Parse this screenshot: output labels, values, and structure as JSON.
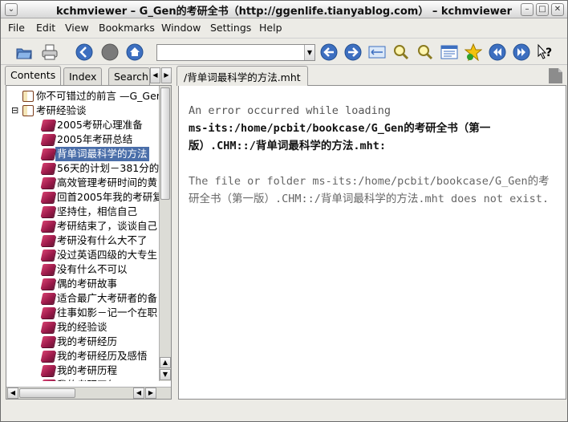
{
  "window": {
    "title": "kchmviewer – G_Gen的考研全书（http://ggenlife.tianyablog.com） – kchmviewer"
  },
  "menu": [
    {
      "label": "File"
    },
    {
      "label": "Edit"
    },
    {
      "label": "View"
    },
    {
      "label": "Bookmarks"
    },
    {
      "label": "Window"
    },
    {
      "label": "Settings"
    },
    {
      "label": "Help"
    }
  ],
  "toolbar": {
    "icons": [
      "open-icon",
      "print-icon",
      "back-icon",
      "stop-icon",
      "home-icon",
      "prev-icon",
      "next-icon",
      "fit-icon",
      "zoom-in-icon",
      "zoom-out-icon",
      "view-source-icon",
      "bookmark-star-icon",
      "rewind-icon",
      "forward-icon",
      "whats-this-icon"
    ],
    "address_value": ""
  },
  "sidebar": {
    "tabs": [
      {
        "label": "Contents"
      },
      {
        "label": "Index"
      },
      {
        "label": "Search"
      }
    ],
    "tree": [
      {
        "label": "你不可错过的前言 —G_Gen",
        "level": 0,
        "expander": "",
        "open": true,
        "selected": false
      },
      {
        "label": "考研经验谈",
        "level": 0,
        "expander": "⊟",
        "open": true,
        "selected": false
      },
      {
        "label": "2005考研心理准备",
        "level": 1,
        "selected": false
      },
      {
        "label": "2005年考研总结",
        "level": 1,
        "selected": false
      },
      {
        "label": "背单词最科学的方法",
        "level": 1,
        "selected": true
      },
      {
        "label": "56天的计划－381分的",
        "level": 1,
        "selected": false
      },
      {
        "label": "高效管理考研时间的黄",
        "level": 1,
        "selected": false
      },
      {
        "label": "回首2005年我的考研复",
        "level": 1,
        "selected": false
      },
      {
        "label": "坚持住，相信自己",
        "level": 1,
        "selected": false
      },
      {
        "label": "考研结束了，谈谈自己",
        "level": 1,
        "selected": false
      },
      {
        "label": "考研没有什么大不了",
        "level": 1,
        "selected": false
      },
      {
        "label": "没过英语四级的大专生",
        "level": 1,
        "selected": false
      },
      {
        "label": "没有什么不可以",
        "level": 1,
        "selected": false
      },
      {
        "label": "偶的考研故事",
        "level": 1,
        "selected": false
      },
      {
        "label": "适合最广大考研者的备",
        "level": 1,
        "selected": false
      },
      {
        "label": "往事如影－记一个在职",
        "level": 1,
        "selected": false
      },
      {
        "label": "我的经验谈",
        "level": 1,
        "selected": false
      },
      {
        "label": "我的考研经历",
        "level": 1,
        "selected": false
      },
      {
        "label": "我的考研经历及感悟",
        "level": 1,
        "selected": false
      },
      {
        "label": "我的考研历程",
        "level": 1,
        "selected": false
      },
      {
        "label": "我的考研四年",
        "level": 1,
        "selected": false
      }
    ]
  },
  "document": {
    "tab_label": "/背单词最科学的方法.mht",
    "error_line1": "An error occurred while loading",
    "error_path": "ms-its:/home/pcbit/bookcase/G_Gen的考研全书（第一版）.CHM::/背单词最科学的方法.mht:",
    "error_msg": "The file or folder ms-its:/home/pcbit/bookcase/G_Gen的考研全书（第一版）.CHM::/背单词最科学的方法.mht does not exist."
  }
}
